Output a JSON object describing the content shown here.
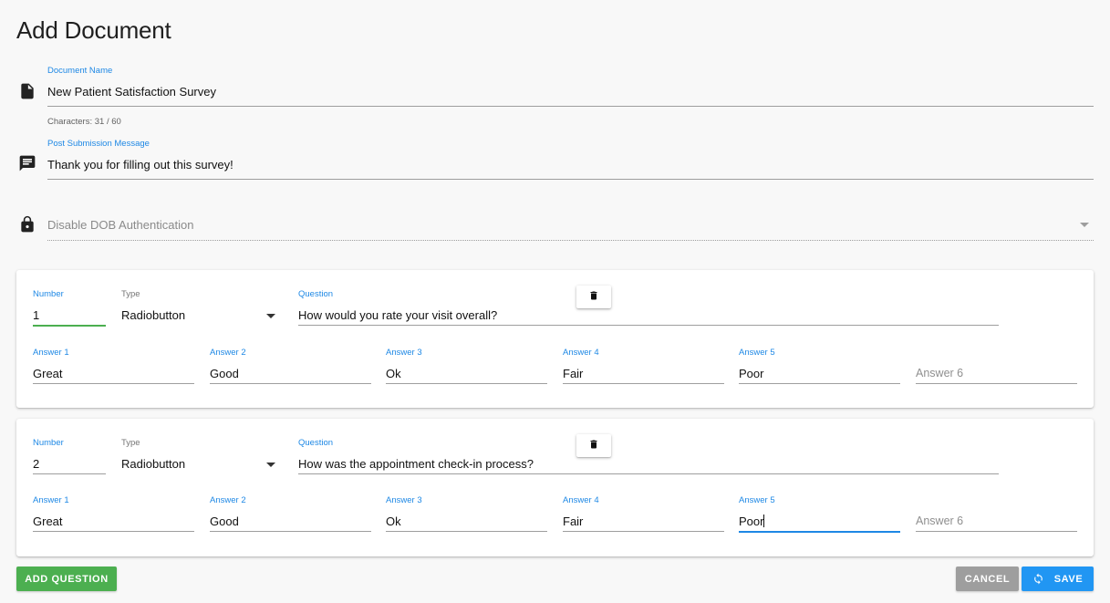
{
  "page": {
    "title": "Add Document"
  },
  "document_name": {
    "label": "Document Name",
    "value": "New Patient Satisfaction Survey",
    "helper": "Characters: 31 / 60"
  },
  "post_message": {
    "label": "Post Submission Message",
    "value": "Thank you for filling out this survey!"
  },
  "dob_auth": {
    "placeholder": "Disable DOB Authentication"
  },
  "questions": [
    {
      "number_label": "Number",
      "number": "1",
      "type_label": "Type",
      "type": "Radiobutton",
      "question_label": "Question",
      "question": "How would you rate your visit overall?",
      "answers": [
        {
          "label": "Answer 1",
          "value": "Great"
        },
        {
          "label": "Answer 2",
          "value": "Good"
        },
        {
          "label": "Answer 3",
          "value": "Ok"
        },
        {
          "label": "Answer 4",
          "value": "Fair"
        },
        {
          "label": "Answer 5",
          "value": "Poor"
        },
        {
          "label": "Answer 6",
          "value": ""
        }
      ]
    },
    {
      "number_label": "Number",
      "number": "2",
      "type_label": "Type",
      "type": "Radiobutton",
      "question_label": "Question",
      "question": "How was the appointment check-in process?",
      "answers": [
        {
          "label": "Answer 1",
          "value": "Great"
        },
        {
          "label": "Answer 2",
          "value": "Good"
        },
        {
          "label": "Answer 3",
          "value": "Ok"
        },
        {
          "label": "Answer 4",
          "value": "Fair"
        },
        {
          "label": "Answer 5",
          "value": "Poor"
        },
        {
          "label": "Answer 6",
          "value": ""
        }
      ]
    }
  ],
  "actions": {
    "add_question": "ADD QUESTION",
    "cancel": "CANCEL",
    "save": "SAVE"
  },
  "icons": {
    "document": "file-icon",
    "message": "message-icon",
    "lock": "lock-icon",
    "delete": "trash-icon",
    "save": "sync-icon"
  },
  "colors": {
    "accent_blue": "#1e88e5",
    "green": "#4caf50",
    "save_blue": "#2196f3",
    "cancel_grey": "#9e9e9e"
  }
}
